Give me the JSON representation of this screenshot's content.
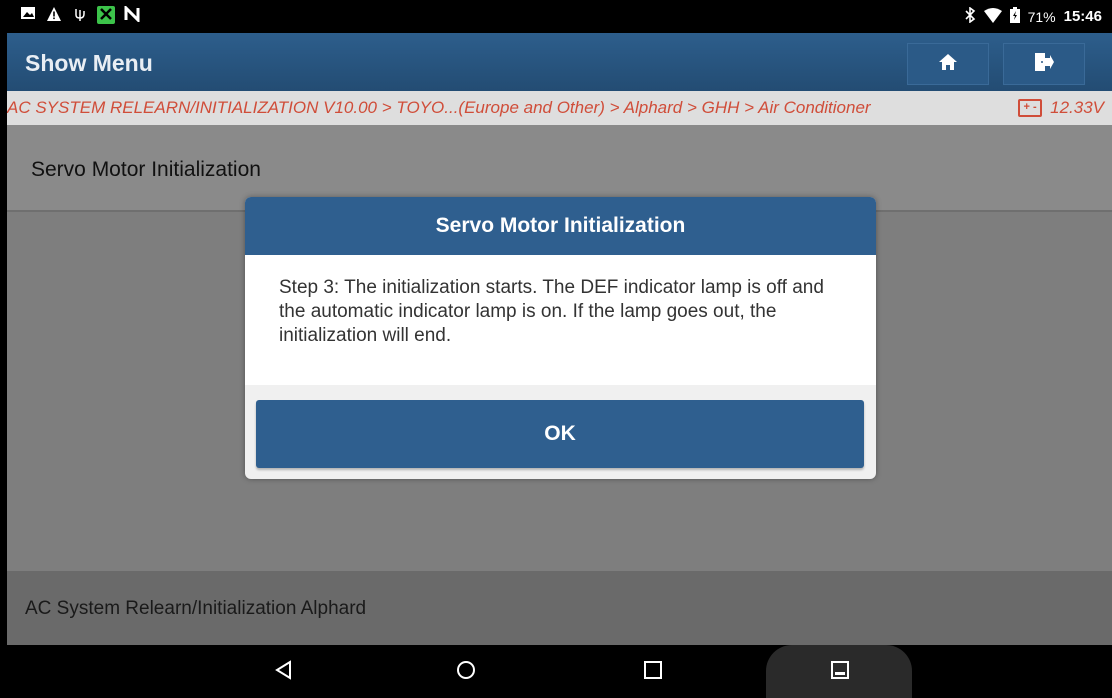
{
  "status_bar": {
    "left_icons": [
      "image-icon",
      "warning-icon",
      "usb-icon",
      "app-icon",
      "n-icon"
    ],
    "battery": "71%",
    "time": "15:46"
  },
  "header": {
    "title": "Show Menu"
  },
  "breadcrumb": {
    "path": "AC SYSTEM RELEARN/INITIALIZATION V10.00 > TOYO...(Europe and Other) > Alphard > GHH > Air Conditioner",
    "voltage": "12.33V"
  },
  "page": {
    "heading": "Servo Motor Initialization",
    "footer": "AC System Relearn/Initialization Alphard"
  },
  "dialog": {
    "title": "Servo Motor Initialization",
    "message": "Step 3: The initialization starts. The DEF indicator lamp is off and the automatic indicator lamp is on. If the lamp goes out, the initialization will end.",
    "ok_label": "OK"
  },
  "colors": {
    "header": "#2d5e8c",
    "breadcrumb_text": "#d04d39",
    "dialog_title": "#2f5f8f"
  }
}
